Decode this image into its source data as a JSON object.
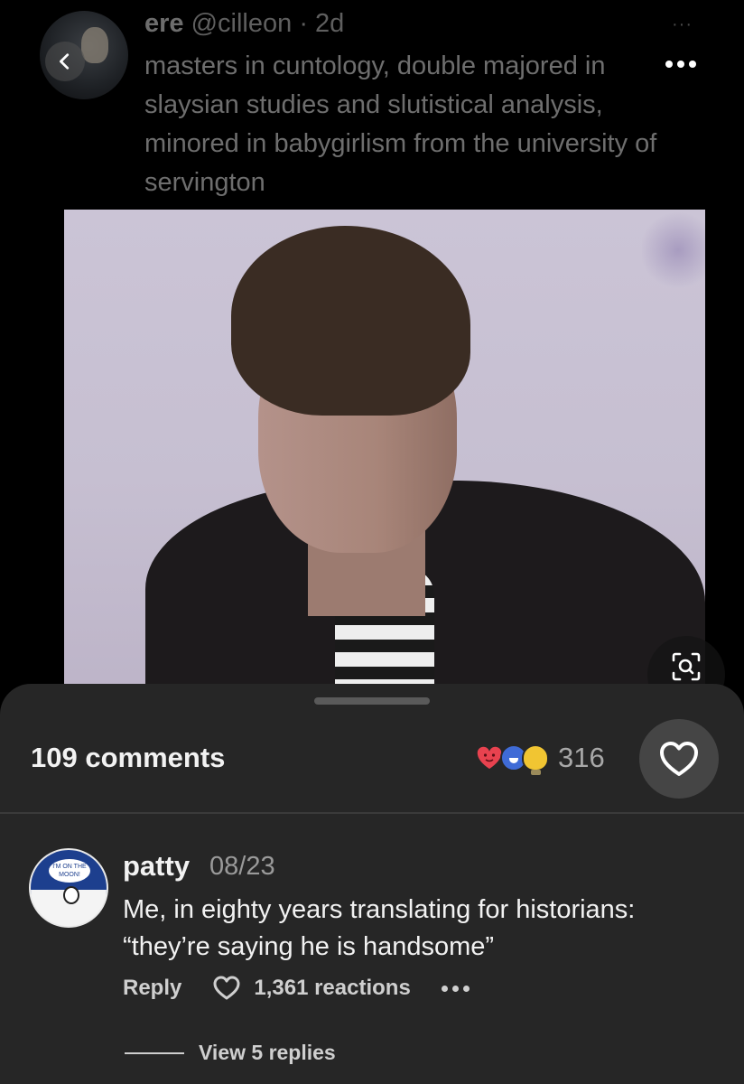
{
  "tweet": {
    "display_name": "ere",
    "handle": "@cilleon",
    "age": "· 2d",
    "text": "masters in cuntology, double majored in slaysian studies and slutistical analysis, minored in babygirlism from the university of servington"
  },
  "comments_sheet": {
    "count_label": "109 comments",
    "reaction_total": "316",
    "reaction_emojis": [
      "heart-emoji",
      "smile-emoji",
      "bulb-emoji"
    ],
    "comment": {
      "author": "patty",
      "date": "08/23",
      "avatar_badge_text": "I'M ON THE MOON!",
      "text": "Me, in eighty years translating for historians: “they’re saying he is handsome”",
      "reply_label": "Reply",
      "reactions_label": "1,361 reactions",
      "view_replies_label": "View 5 replies"
    }
  },
  "colors": {
    "sheet_bg": "#262626",
    "like_button_bg": "#454545",
    "reaction_heart": "#e8424f",
    "reaction_smile": "#3f6bd6",
    "reaction_bulb": "#f1c532"
  }
}
